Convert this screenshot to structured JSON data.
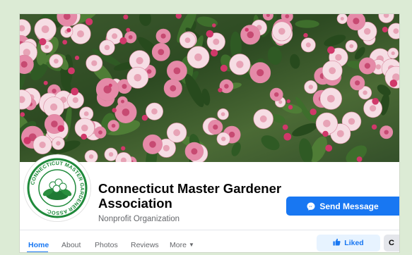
{
  "page": {
    "name": "Connecticut Master Gardener Association",
    "category": "Nonprofit Organization",
    "logo_text": "CONNECTICUT MASTER GARDENER ASSOC."
  },
  "actions": {
    "send_message_label": "Send Message",
    "liked_label": "Liked",
    "more_label": "C"
  },
  "nav": {
    "tabs": [
      {
        "label": "Home",
        "active": true
      },
      {
        "label": "About",
        "active": false
      },
      {
        "label": "Photos",
        "active": false
      },
      {
        "label": "Reviews",
        "active": false
      },
      {
        "label": "More",
        "active": false
      }
    ]
  },
  "icons": {
    "send": "messenger-icon",
    "liked": "thumbs-up-icon",
    "more_caret": "caret-down-icon"
  },
  "colors": {
    "accent": "#1877f2",
    "liked_bg": "#e7f3ff",
    "logo_green": "#1f8a3b",
    "page_bg": "#dcebd5"
  }
}
